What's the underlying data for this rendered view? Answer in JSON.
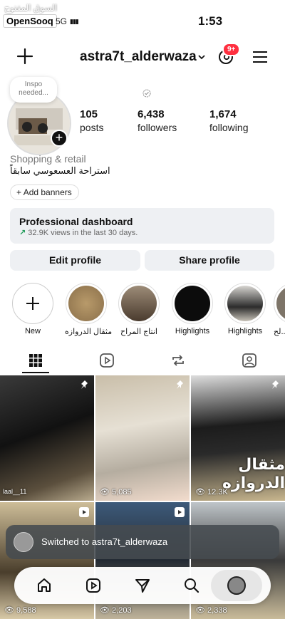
{
  "status_bar": {
    "watermark": "السوق المفتوح",
    "brand": "OpenSooq",
    "signal": "5G",
    "time": "1:53"
  },
  "header": {
    "username": "astra7t_alderwaza",
    "notification_badge": "9+"
  },
  "profile": {
    "note": "Inspo needed...",
    "stats": [
      {
        "value": "105",
        "label": "posts"
      },
      {
        "value": "6,438",
        "label": "followers"
      },
      {
        "value": "1,674",
        "label": "following"
      }
    ],
    "category": "Shopping & retail",
    "bio": "استراحة العسعوسي سابقاً",
    "add_banners": "Add banners"
  },
  "dashboard": {
    "title": "Professional dashboard",
    "subtitle": "32.9K views in the last 30 days."
  },
  "actions": {
    "edit_profile": "Edit profile",
    "share_profile": "Share profile"
  },
  "highlights": [
    {
      "label": "New"
    },
    {
      "label": "مثقال الدروازه"
    },
    {
      "label": "انتاج المراح"
    },
    {
      "label": "Highlights"
    },
    {
      "label": "Highlights"
    },
    {
      "label": "لح..."
    }
  ],
  "grid": {
    "cells": [
      {
        "views": "",
        "caption": "laal__11"
      },
      {
        "views": "5,085",
        "caption": ""
      },
      {
        "views": "12.3K",
        "caption": "مثقال الدروازه"
      },
      {
        "views": "9,588",
        "caption": ""
      },
      {
        "views": "2,203",
        "caption": ""
      },
      {
        "views": "2,338",
        "caption": ""
      }
    ]
  },
  "toast": {
    "text": "Switched to astra7t_alderwaza"
  },
  "icons": {
    "nav": [
      "home-icon",
      "reels-icon",
      "send-icon",
      "search-icon",
      "profile-avatar"
    ]
  }
}
